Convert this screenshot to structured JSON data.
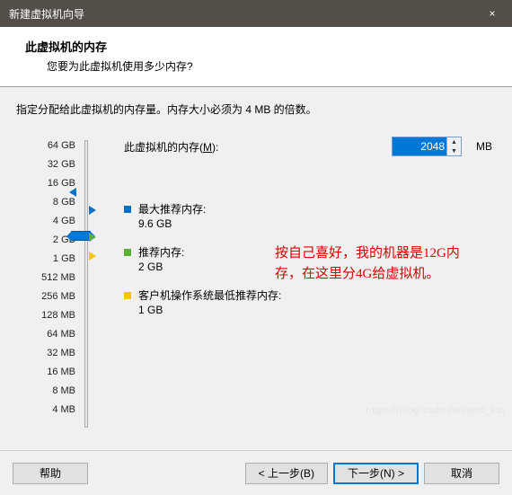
{
  "window": {
    "title": "新建虚拟机向导",
    "close_icon": "×"
  },
  "header": {
    "title": "此虚拟机的内存",
    "subtitle": "您要为此虚拟机使用多少内存?"
  },
  "content": {
    "desc": "指定分配给此虚拟机的内存量。内存大小必须为 4 MB 的倍数。",
    "mem_label_pre": "此虚拟机的内存(",
    "mem_label_key": "M",
    "mem_label_post": "):",
    "mem_value": "2048",
    "mem_unit": "MB",
    "ticks": [
      "64 GB",
      "32 GB",
      "16 GB",
      "8 GB",
      "4 GB",
      "2 GB",
      "1 GB",
      "512 MB",
      "256 MB",
      "128 MB",
      "64 MB",
      "32 MB",
      "16 MB",
      "8 MB",
      "4 MB"
    ],
    "max_label": "最大推荐内存:",
    "max_value": "9.6 GB",
    "rec_label": "推荐内存:",
    "rec_value": "2 GB",
    "min_label": "客户机操作系统最低推荐内存:",
    "min_value": "1 GB",
    "annotation": "按自己喜好，我的机器是12G内存，在这里分4G给虚拟机。"
  },
  "footer": {
    "help": "帮助",
    "back": "< 上一步(B)",
    "next": "下一步(N) >",
    "cancel": "取消"
  },
  "watermark": "https://blog.csdn.net/and_kai"
}
